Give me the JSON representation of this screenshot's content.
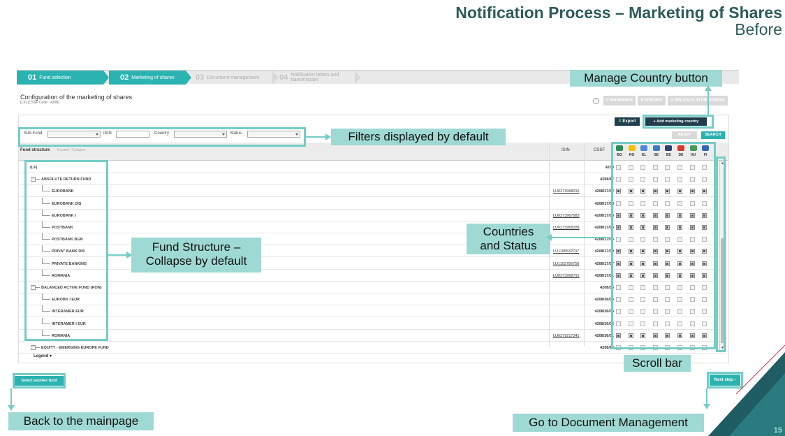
{
  "slide": {
    "title": "Notification Process – Marketing of Shares",
    "subtitle": "Before",
    "page_number": "15"
  },
  "steps": [
    {
      "num": "01",
      "label": "Fund selection"
    },
    {
      "num": "02",
      "label": "Marketing of shares"
    },
    {
      "num": "03",
      "label": "Document management"
    },
    {
      "num": "04",
      "label": "Notification letters and transmission"
    }
  ],
  "config": {
    "title": "Configuration of the marketing of shares",
    "subtitle": "(LF) (CSSF Code : 4208)"
  },
  "badges": {
    "warnings": "0 WARNINGS",
    "errors": "0 ERRORS",
    "uploads": "0 UPLOADS IN PROGRESS"
  },
  "toolbar": {
    "export_label": "Export",
    "add_country_label": "+ Add marketing country"
  },
  "filters": {
    "subfund_label": "Sub-Fund",
    "isin_label": "ISIN",
    "country_label": "Country",
    "status_label": "Status",
    "reset_label": "RESET",
    "search_label": "SEARCH"
  },
  "table": {
    "fund_header": "Fund structure",
    "expand_label": "Expand / Collapse",
    "isin_header": "ISIN",
    "cssf_header": "CSSF",
    "countries": [
      {
        "code": "BG",
        "color": "#2e8b57"
      },
      {
        "code": "RO",
        "color": "#f2c200"
      },
      {
        "code": "EL",
        "color": "#4a8ad4"
      },
      {
        "code": "SE",
        "color": "#3a7bc8"
      },
      {
        "code": "EE",
        "color": "#2a3f6e"
      },
      {
        "code": "DE",
        "color": "#d63a2a"
      },
      {
        "code": "HU",
        "color": "#3f9b55"
      },
      {
        "code": "FI",
        "color": "#3366bb"
      }
    ],
    "rows": [
      {
        "name": "(LF)",
        "isin": "",
        "cssf": "4208",
        "level": 0
      },
      {
        "name": "ABSOLUTE RETURN FUND",
        "isin": "",
        "cssf": "4208/17",
        "level": 1
      },
      {
        "name": "EUROBANK",
        "isin": "LU0273968015",
        "cssf": "4208/17/02",
        "level": 2
      },
      {
        "name": "EUROBANK DIS",
        "isin": "",
        "cssf": "4208/17/08",
        "level": 2
      },
      {
        "name": "EUROBANK I",
        "isin": "LU0273967983",
        "cssf": "4208/17/03",
        "level": 2
      },
      {
        "name": "POSTBANK",
        "isin": "LU0273968288",
        "cssf": "4208/17/05",
        "level": 2
      },
      {
        "name": "POSTBANK BGN",
        "isin": "",
        "cssf": "4208/17/06",
        "level": 2
      },
      {
        "name": "PRIVAT BANK DIS",
        "isin": "LU1195532707",
        "cssf": "4208/17/09",
        "level": 2
      },
      {
        "name": "PRIVATE BANKING",
        "isin": "LU1102786750",
        "cssf": "4208/17/07",
        "level": 2
      },
      {
        "name": "ROMANIA",
        "isin": "LU0273968791",
        "cssf": "4208/17/01",
        "level": 2
      },
      {
        "name": "BALANCED ACTIVE FUND (RON)",
        "isin": "",
        "cssf": "4208/36",
        "level": 1
      },
      {
        "name": "EUROBK I EUR",
        "isin": "",
        "cssf": "4208/36/03",
        "level": 2
      },
      {
        "name": "INTERAMER EUR",
        "isin": "",
        "cssf": "4208/36/04",
        "level": 2
      },
      {
        "name": "INTERAMER I EUR",
        "isin": "",
        "cssf": "4208/36/05",
        "level": 2
      },
      {
        "name": "ROMANIA",
        "isin": "LU0379217341",
        "cssf": "4208/36/01",
        "level": 2
      },
      {
        "name": "EQUITY - EMERGING EUROPE FUND",
        "isin": "",
        "cssf": "4208/10",
        "level": 1
      }
    ],
    "legend_label": "Legend"
  },
  "nav": {
    "select_fund_label": "Select another fund",
    "next_step_label": "Next step"
  },
  "callouts": {
    "manage_country": "Manage Country button",
    "filters": "Filters displayed by default",
    "countries_status": "Countries\nand Status",
    "fund_structure": "Fund Structure –\nCollapse by default",
    "scroll_bar": "Scroll bar",
    "back_mainpage": "Back to the mainpage",
    "go_doc_mgmt": "Go to Document Management"
  },
  "colors": {
    "accent": "#2bb3b1",
    "annotation": "#74cdc6",
    "callout_bg": "#9fd9d3",
    "dark_button": "#1f3d4c",
    "title": "#2d5c5a"
  }
}
